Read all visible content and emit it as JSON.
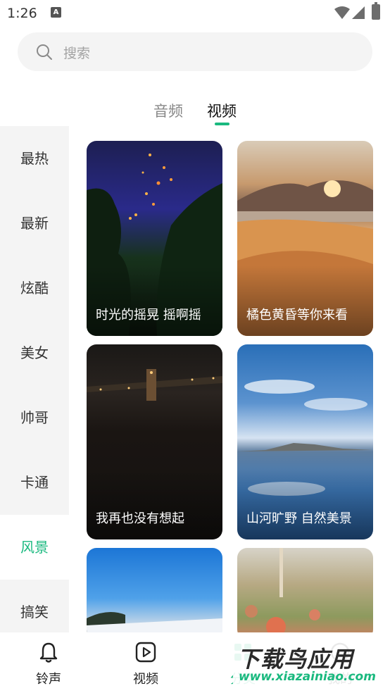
{
  "status_bar": {
    "time": "1:26",
    "notification_letter": "A"
  },
  "search": {
    "placeholder": "搜索"
  },
  "tabs": [
    {
      "label": "音频",
      "active": false
    },
    {
      "label": "视频",
      "active": true
    }
  ],
  "sidebar": {
    "items": [
      {
        "label": "最热",
        "active": false
      },
      {
        "label": "最新",
        "active": false
      },
      {
        "label": "炫酷",
        "active": false
      },
      {
        "label": "美女",
        "active": false
      },
      {
        "label": "帅哥",
        "active": false
      },
      {
        "label": "卡通",
        "active": false
      },
      {
        "label": "风景",
        "active": true
      },
      {
        "label": "搞笑",
        "active": false
      }
    ]
  },
  "videos": [
    {
      "title": "时光的摇晃 摇啊摇"
    },
    {
      "title": "橘色黄昏等你来看"
    },
    {
      "title": "我再也没有想起"
    },
    {
      "title": "山河旷野 自然美景"
    },
    {
      "title": ""
    },
    {
      "title": ""
    }
  ],
  "bottom_nav": [
    {
      "label": "铃声",
      "icon": "bell-icon",
      "active": false
    },
    {
      "label": "视频",
      "icon": "play-icon",
      "active": false
    },
    {
      "label": "分类",
      "icon": "category-icon",
      "active": true
    },
    {
      "label": "我的",
      "icon": "profile-icon",
      "active": false
    }
  ],
  "watermark": {
    "main": "下载鸟应用",
    "sub": "www.xiazainiao.com"
  },
  "colors": {
    "accent": "#1ab97f",
    "sidebar_bg": "#f4f4f4",
    "search_bg": "#f4f4f4"
  }
}
